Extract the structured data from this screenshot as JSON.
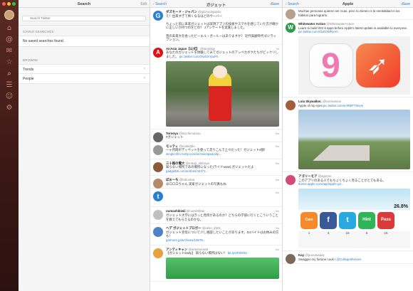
{
  "window": {
    "lights": [
      "#ff5f57",
      "#febc2e",
      "#28c840"
    ]
  },
  "sidebar": {
    "icons": [
      "home-icon",
      "at-icon",
      "mail-icon",
      "star-icon",
      "search-icon",
      "list-icon",
      "profile-icon",
      "gear-icon",
      "drafts-icon",
      "muted-icon"
    ]
  },
  "col1": {
    "title": "Search",
    "edit": "Edit",
    "search_placeholder": "Search Twitter",
    "saved_header": "SAVED SEARCHES",
    "saved_empty": "No saved searches found.",
    "browse_header": "BROWSE",
    "browse_items": [
      "Trends",
      "People"
    ]
  },
  "col2": {
    "back": "Search",
    "title": "ガジェット",
    "save": "Save",
    "tweets": [
      {
        "name": "ダズモード・ジャパン",
        "handle": "@gizmodojapan",
        "time": "",
        "text": "え！出来すぎて怖くなるほどのウーバー",
        "link": "",
        "color": "#2a7fd4",
        "icon": "G"
      },
      {
        "name": "",
        "handle": "",
        "time": "",
        "text": "ちょっと前に未来ガジェットは実現アプリの技術やスマホを感じていた方が確かに正しいか持つのをどの？ Jアンケートを実施しました。",
        "link": "",
        "color": "#fff",
        "icon": ""
      },
      {
        "name": "",
        "handle": "",
        "time": "",
        "text": "昔の未来大を会ったビーエル・ガールーはありますか？ 近代高齢時代ゴジラップション。",
        "link": "",
        "color": "#fff",
        "icon": ""
      },
      {
        "name": "AirAsia Japan【公式】",
        "handle": "@airasiajp",
        "time": "3h",
        "text": "あなたのガジェットを体験してみてガジェットのアッペカボクたちがビックリしました。",
        "link": "pic.twitter.com/zNxbXYpuPs",
        "color": "#e0101a",
        "icon": "A"
      },
      {
        "name": "Tornoya",
        "handle": "@tsuchimotooo",
        "time": "3m",
        "text": "#ガジェット",
        "link": "",
        "color": "#666",
        "icon": ""
      },
      {
        "name": "モッティ",
        "handle": "@motkiddo",
        "time": "3m",
        "text": "一ヶ月間ボディペットを使って走りこんで上々だった！ガジェット4個！",
        "link": "simple-life-motty.com/archive/ipad.php...",
        "color": "#999",
        "icon": ""
      },
      {
        "name": "三十路の電大",
        "handle": "@misoji_shibuya",
        "time": "3m",
        "text": "知らない場所であの場所になった(ライドwww) ガジェットだよ",
        "link": "gadgetbb.com/entries/44471...",
        "color": "#8e5a3b",
        "icon": ""
      },
      {
        "name": "ぽぉーち",
        "handle": "@toboolaa",
        "time": "3m",
        "text": "@ロロロちゃん 実家ガジェットの写真もね",
        "link": "",
        "color": "#b48a6a",
        "icon": ""
      },
      {
        "name": "",
        "handle": "",
        "time": "3m",
        "text": "",
        "link": "",
        "color": "#2a7fd4",
        "icon": "t"
      },
      {
        "name": "oumashikiwii",
        "handle": "@ousshikiwii",
        "time": "3m",
        "text": "ガジェット大学にはきっと見所があるのか？どちらの学部に行くとこういうことを教えてもらえるのかな。",
        "link": "",
        "color": "#c0c0c0",
        "icon": ""
      },
      {
        "name": "ヘデ ガジェットブロガー",
        "handle": "@neko_1001",
        "time": "3m",
        "text": "ガジェット宣伝について少し相談したいことがあります。DJバイトはお休みの方も！",
        "link": "getmore.jp/archives/10678...",
        "color": "#4c84c5",
        "icon": ""
      },
      {
        "name": "アンティキャン",
        "handle": "@antieneru69",
        "time": "3m",
        "text": "【ガジェットDaily】 知らない場所はない！",
        "link": "bit.ly/1RrDthU",
        "color": "#e8a13b",
        "icon": ""
      }
    ]
  },
  "col3": {
    "back": "Search",
    "title": "Apple",
    "save": "Save",
    "tweets": [
      {
        "name": "",
        "handle": "",
        "time": "",
        "text": "Muchas personas quieren ser ricas, pero no tienen ni la mentalidad ni los hábitos para lograrlo.",
        "link": "",
        "color": "#b7a08d",
        "icon": ""
      },
      {
        "name": "Whitewater Action",
        "handle": "@WhitewaterAction",
        "time": "",
        "text": "Learn to build iOS 9 apps before Apple's latest update is available to everyone.",
        "link": "pic.twitter.com/CbZOWRuVn",
        "color": "#2e9b4a",
        "icon": "W"
      },
      {
        "name": "Lola Skywalker.",
        "handle": "@lorenamian",
        "time": "",
        "text": "Apple of my eyes",
        "link": "pic.twitter.com/eJRMTTlmvm",
        "color": "#a45c3c",
        "icon": ""
      },
      {
        "name": "アゴリーモア",
        "handle": "@agoimo",
        "time": "",
        "text": "このアプリのある人でもちょくちょく見ることがとてもある。",
        "link": "itunes.apple.com/app/apple-gir...",
        "color": "#d24a78",
        "icon": ""
      },
      {
        "name": "Kay",
        "handle": "@puxciwaaay",
        "time": "",
        "text": "Swagger my fortune cook !",
        "link": "@Collegeithemen",
        "color": "#7a6a5a",
        "icon": ""
      }
    ],
    "swift_label": "Swift",
    "ios_label": "9",
    "progress": "26.8%",
    "apps": [
      {
        "label": "Cam",
        "color": "#f48a2b"
      },
      {
        "label": "f",
        "color": "#3b5998"
      },
      {
        "label": "t",
        "color": "#29a9e1"
      },
      {
        "label": "Hint",
        "color": "#2fb457"
      },
      {
        "label": "Pass",
        "color": "#d93a3a"
      }
    ],
    "app_nums": [
      "1",
      "4",
      "15",
      "6",
      "15"
    ]
  }
}
